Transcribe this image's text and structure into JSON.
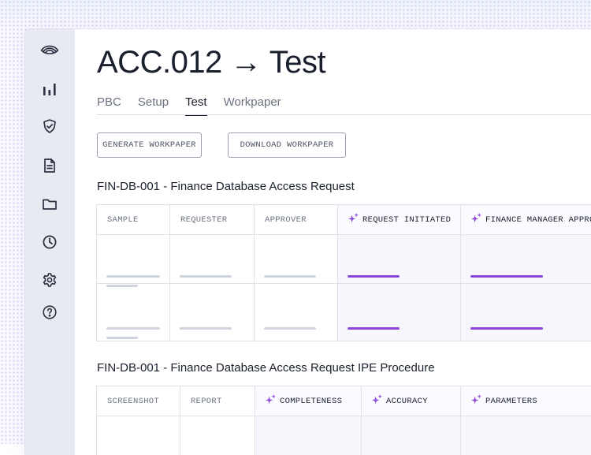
{
  "page": {
    "title": "ACC.012 → Test"
  },
  "sidebar": {
    "items": [
      {
        "icon": "eye-logo-icon"
      },
      {
        "icon": "bar-chart-icon"
      },
      {
        "icon": "shield-check-icon"
      },
      {
        "icon": "document-icon"
      },
      {
        "icon": "folder-icon"
      },
      {
        "icon": "clock-icon"
      },
      {
        "icon": "gear-icon"
      },
      {
        "icon": "help-icon"
      }
    ]
  },
  "tabs": [
    {
      "label": "PBC"
    },
    {
      "label": "Setup"
    },
    {
      "label": "Test",
      "active": true
    },
    {
      "label": "Workpaper"
    }
  ],
  "actions": {
    "generate_label": "GENERATE WORKPAPER",
    "download_label": "DOWNLOAD WORKPAPER"
  },
  "section1": {
    "title": "FIN-DB-001 - Finance Database Access Request",
    "columns": [
      "SAMPLE",
      "REQUESTER",
      "APPROVER",
      "REQUEST INITIATED",
      "FINANCE MANAGER APPROVAL"
    ]
  },
  "section2": {
    "title": "FIN-DB-001 - Finance Database Access Request IPE Procedure",
    "columns": [
      "SCREENSHOT",
      "REPORT",
      "COMPLETENESS",
      "ACCURACY",
      "PARAMETERS"
    ]
  },
  "colors": {
    "accent": "#8b46d9",
    "sidebar_bg": "#e7eaf0",
    "placeholder": "#cfd4dd"
  }
}
